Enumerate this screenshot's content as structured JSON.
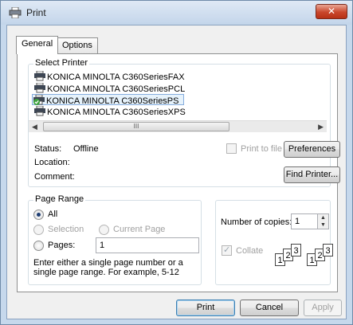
{
  "window": {
    "title": "Print",
    "close_label": "✕"
  },
  "tabs": [
    {
      "label": "General",
      "active": true
    },
    {
      "label": "Options",
      "active": false
    }
  ],
  "select_printer": {
    "label": "Select Printer",
    "printers": [
      {
        "name": "KONICA MINOLTA C360SeriesFAX",
        "selected": false
      },
      {
        "name": "KONICA MINOLTA C360SeriesPCL",
        "selected": false
      },
      {
        "name": "KONICA MINOLTA C360SeriesPS",
        "selected": true
      },
      {
        "name": "KONICA MINOLTA C360SeriesXPS",
        "selected": false
      }
    ],
    "scroll_thumb_grip": "III",
    "status_label": "Status:",
    "status_value": "Offline",
    "location_label": "Location:",
    "comment_label": "Comment:",
    "print_to_file_label": "Print to file",
    "preferences_label": "Preferences",
    "find_printer_label": "Find Printer..."
  },
  "page_range": {
    "label": "Page Range",
    "all_label": "All",
    "selection_label": "Selection",
    "current_page_label": "Current Page",
    "pages_label": "Pages:",
    "pages_value": "1",
    "hint": "Enter either a single page number or a single page range.  For example, 5-12"
  },
  "copies": {
    "label": "Number of copies:",
    "value": "1",
    "collate_label": "Collate",
    "collate_pages": [
      "1",
      "2",
      "3"
    ]
  },
  "buttons": {
    "print": "Print",
    "cancel": "Cancel",
    "apply": "Apply"
  },
  "colors": {
    "selection_bg": "#e6f2fb",
    "selection_border": "#84acdd",
    "close_button": "#c9462b",
    "window_frame": "#c6d8ec"
  }
}
